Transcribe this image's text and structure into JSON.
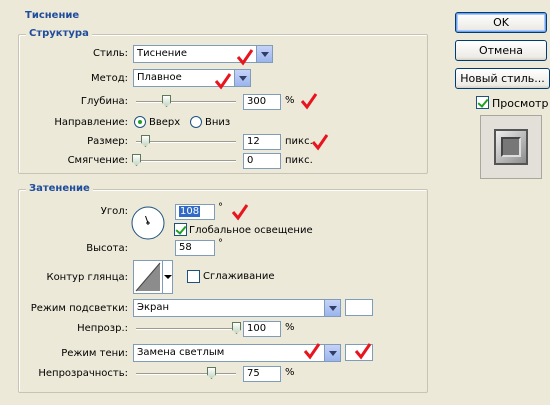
{
  "section_title": "Тиснение",
  "structure": {
    "title": "Структура",
    "style_label": "Стиль:",
    "style_value": "Тиснение",
    "method_label": "Метод:",
    "method_value": "Плавное",
    "depth_label": "Глубина:",
    "depth_value": "300",
    "depth_unit": "%",
    "depth_slider_fraction": 0.3,
    "direction_label": "Направление:",
    "direction_up": "Вверх",
    "direction_down": "Вниз",
    "direction_selected": "up",
    "size_label": "Размер:",
    "size_value": "12",
    "size_unit": "пикс.",
    "size_slider_fraction": 0.09,
    "soften_label": "Смягчение:",
    "soften_value": "0",
    "soften_unit": "пикс.",
    "soften_slider_fraction": 0.0
  },
  "shading": {
    "title": "Затенение",
    "angle_label": "Угол:",
    "angle_value": "108",
    "angle_unit": "°",
    "global_light_label": "Глобальное освещение",
    "global_light_checked": true,
    "altitude_label": "Высота:",
    "altitude_value": "58",
    "altitude_unit": "°",
    "gloss_contour_label": "Контур глянца:",
    "antialias_label": "Сглаживание",
    "antialias_checked": false,
    "highlight_mode_label": "Режим подсветки:",
    "highlight_mode_value": "Экран",
    "highlight_color": "#FFFFFF",
    "highlight_opacity_label": "Непрозр.:",
    "highlight_opacity_value": "100",
    "highlight_opacity_unit": "%",
    "highlight_opacity_fraction": 1.0,
    "shadow_mode_label": "Режим тени:",
    "shadow_mode_value": "Замена светлым",
    "shadow_color": "#FFFFFF",
    "shadow_opacity_label": "Непрозрачность:",
    "shadow_opacity_value": "75",
    "shadow_opacity_unit": "%",
    "shadow_opacity_fraction": 0.75
  },
  "buttons": {
    "ok": "OK",
    "cancel": "Отмена",
    "new_style": "Новый стиль..."
  },
  "preview": {
    "label": "Просмотр",
    "checked": true
  },
  "colors": {
    "group_title": "#1F4C9C",
    "annotation_check": "#E8141E",
    "dialog_bg": "#ECE9D8"
  }
}
